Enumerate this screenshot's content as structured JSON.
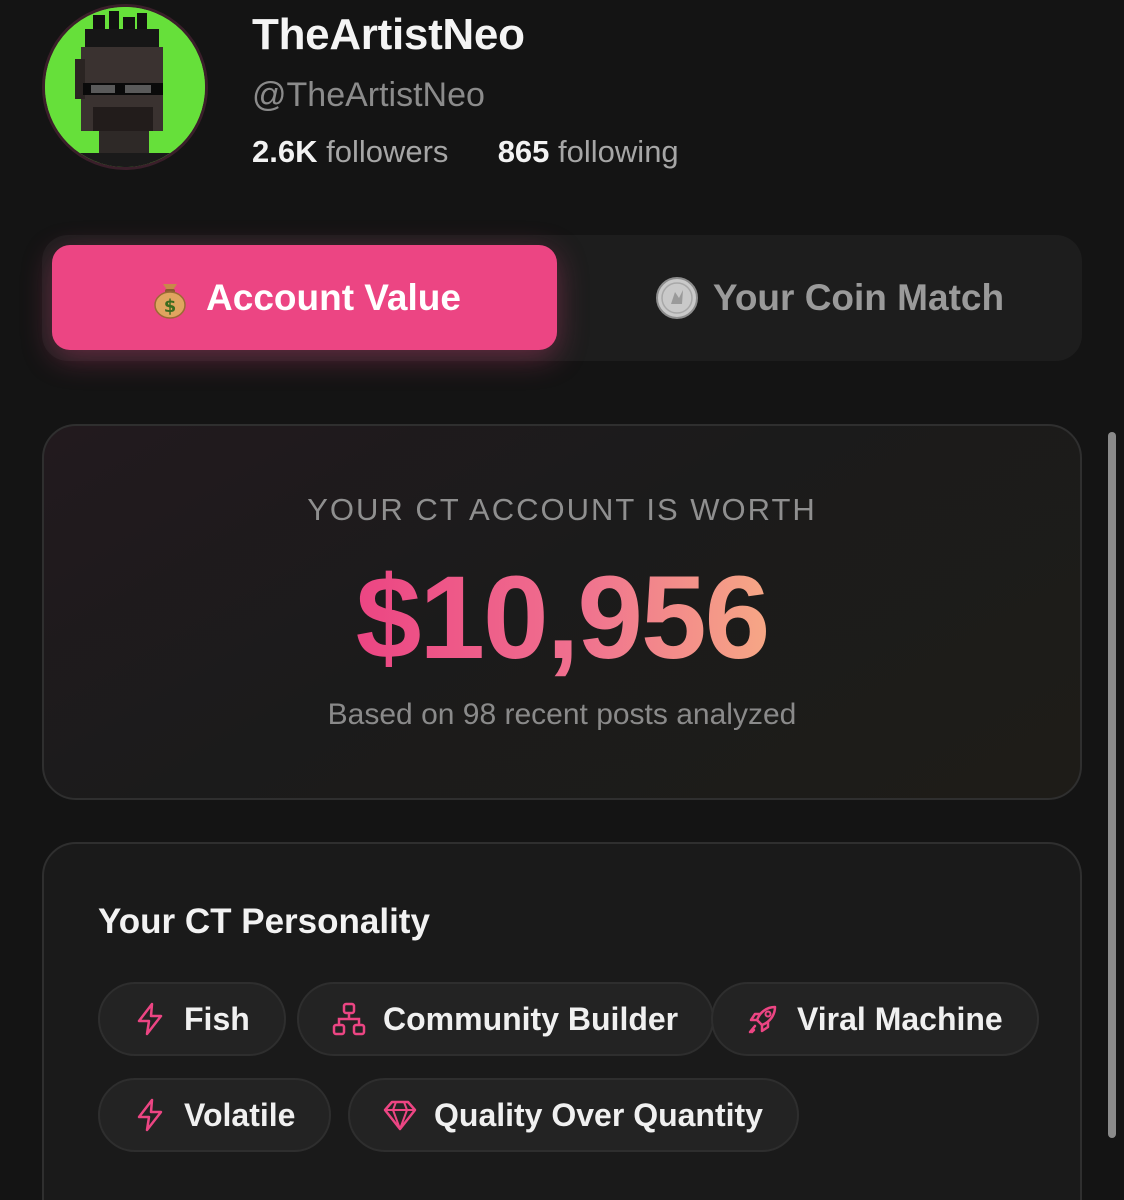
{
  "profile": {
    "name": "TheArtistNeo",
    "handle": "@TheArtistNeo",
    "followers_count": "2.6K",
    "followers_label": "followers",
    "following_count": "865",
    "following_label": "following",
    "avatar_icon": "pixel-art-avatar"
  },
  "tabs": [
    {
      "label": "Account Value",
      "icon": "money-bag-icon",
      "active": true
    },
    {
      "label": "Your Coin Match",
      "icon": "coin-icon",
      "active": false
    }
  ],
  "value_card": {
    "label": "YOUR CT ACCOUNT IS WORTH",
    "amount": "$10,956",
    "subtitle": "Based on 98 recent posts analyzed"
  },
  "personality": {
    "title": "Your CT Personality",
    "traits": [
      {
        "label": "Fish",
        "icon": "lightning-icon"
      },
      {
        "label": "Community Builder",
        "icon": "network-icon"
      },
      {
        "label": "Viral Machine",
        "icon": "rocket-icon"
      },
      {
        "label": "Volatile",
        "icon": "lightning-icon"
      },
      {
        "label": "Quality Over Quantity",
        "icon": "diamond-icon"
      }
    ]
  },
  "colors": {
    "accent": "#ec4583",
    "background": "#141414",
    "card": "#1a1a1a",
    "gradient_end": "#f6a785"
  }
}
